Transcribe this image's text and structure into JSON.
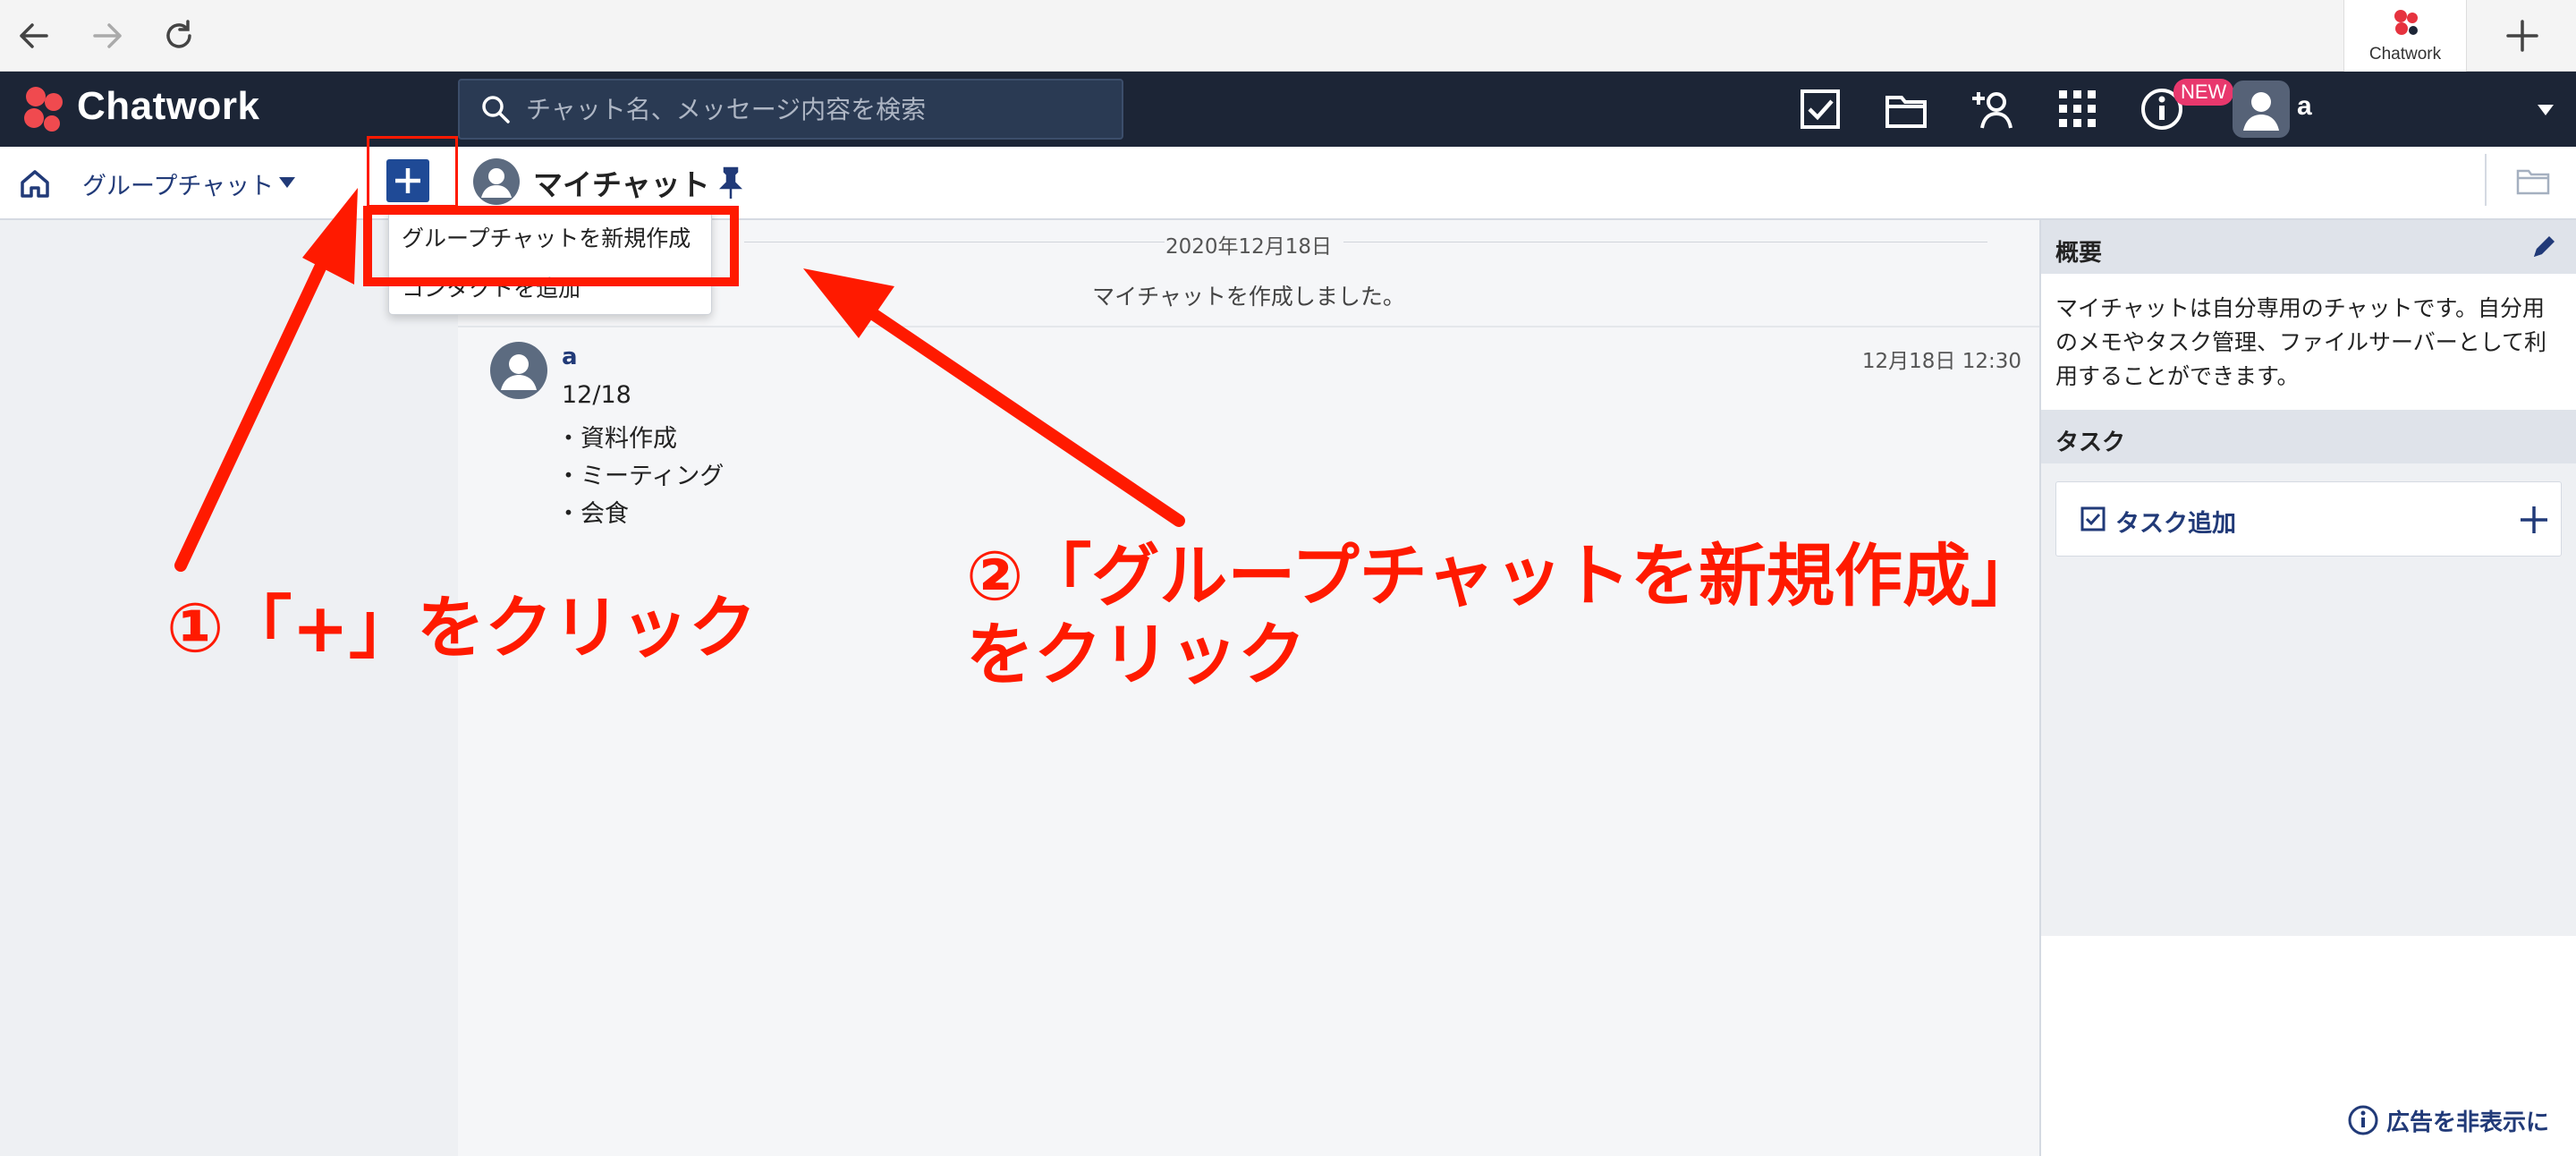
{
  "browser": {
    "tab_title": "Chatwork"
  },
  "header": {
    "brand": "Chatwork",
    "search_placeholder": "チャット名、メッセージ内容を検索",
    "new_badge": "NEW",
    "user_name": "a"
  },
  "subheader": {
    "filter_label": "グループチャット",
    "room_title": "マイチャット"
  },
  "dropdown": {
    "items": [
      "グループチャットを新規作成",
      "コンタクトを追加"
    ]
  },
  "timeline": {
    "date": "2020年12月18日",
    "system_message": "マイチャットを作成しました。",
    "message": {
      "author": "a",
      "time": "12月18日 12:30",
      "lines": [
        "12/18",
        "・資料作成",
        "・ミーティング",
        "・会食"
      ]
    }
  },
  "right_panel": {
    "overview_title": "概要",
    "overview_text": "マイチャットは自分専用のチャットです。自分用のメモやタスク管理、ファイルサーバーとして利用することができます。",
    "task_title": "タスク",
    "task_add_label": "タスク追加",
    "hide_ads": "広告を非表示に"
  },
  "annotations": {
    "step1": "①「+」をクリック",
    "step2_line1": "②「グループチャットを新規作成」",
    "step2_line2": "をクリック"
  },
  "colors": {
    "header_bg": "#1c2536",
    "accent_blue": "#1f4a96",
    "annotation_red": "#ff1a00",
    "badge_pink": "#e8386d"
  }
}
